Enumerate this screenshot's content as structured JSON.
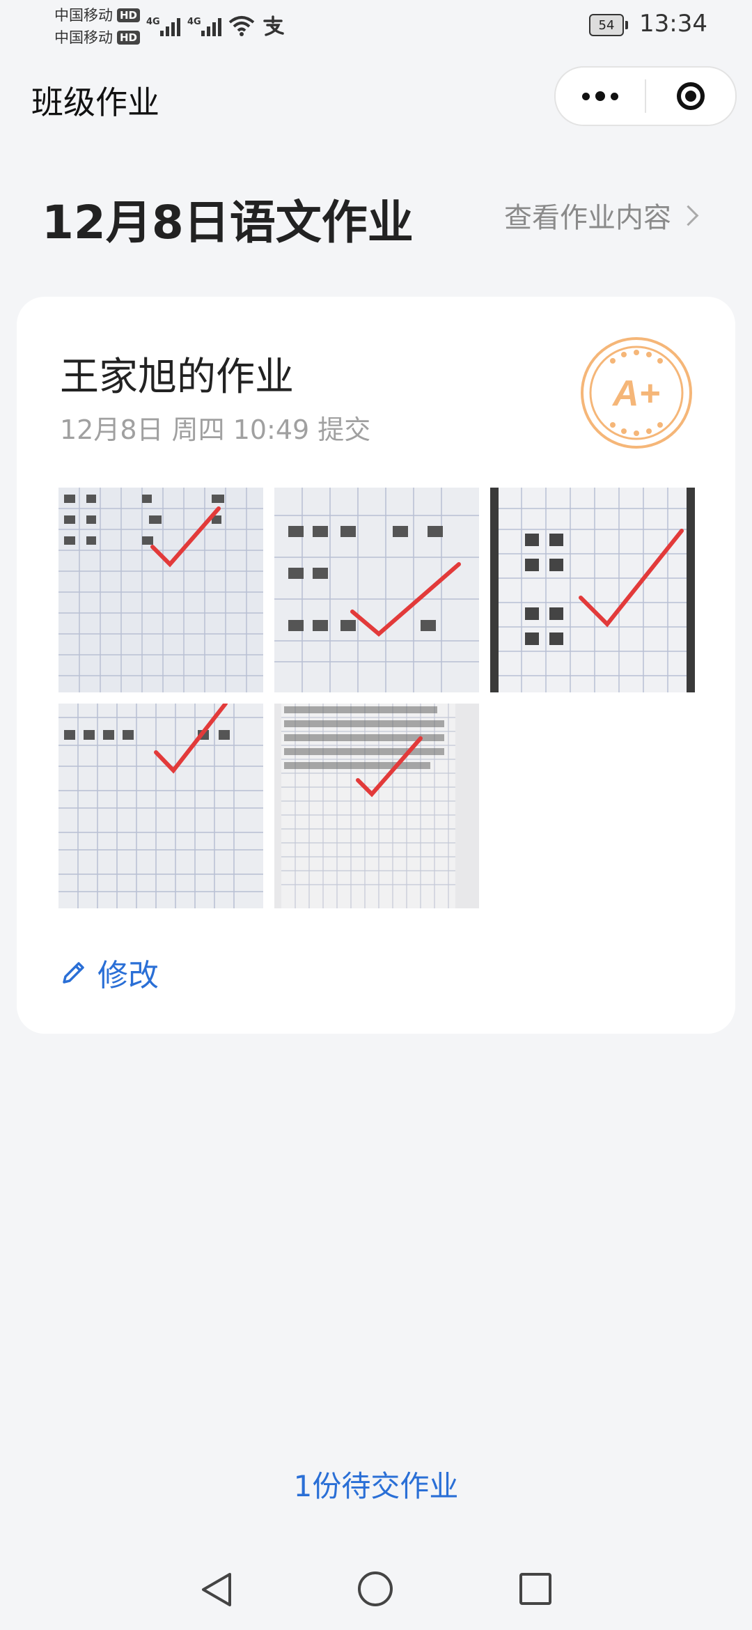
{
  "status_bar": {
    "carrier_1": "中国移动",
    "carrier_2": "中国移动",
    "hd_badge": "HD",
    "network_1": "4G",
    "network_2": "4G",
    "battery": "54",
    "time": "13:34",
    "icons": [
      "signal-icon",
      "signal-icon",
      "wifi-icon",
      "alipay-icon",
      "battery-icon"
    ]
  },
  "app_bar": {
    "title": "班级作业",
    "icons": [
      "more-icon",
      "close-target-icon"
    ]
  },
  "homework": {
    "title": "12月8日语文作业",
    "view_content_label": "查看作业内容",
    "view_content_icon": "chevron-right-icon"
  },
  "submission": {
    "owner_title": "王家旭的作业",
    "submitted_at": "12月8日 周四 10:49 提交",
    "grade": "A+",
    "grade_color": "#f5b678",
    "photo_count": 5,
    "photos": [
      {
        "label": "homework-photo-1"
      },
      {
        "label": "homework-photo-2"
      },
      {
        "label": "homework-photo-3"
      },
      {
        "label": "homework-photo-4"
      },
      {
        "label": "homework-photo-5"
      }
    ],
    "edit_label": "修改",
    "edit_icon": "pencil-icon"
  },
  "pending_label": "1份待交作业",
  "colors": {
    "accent": "#2a6fd6",
    "check_mark": "#e23a3a",
    "background": "#f4f5f7"
  },
  "system_nav": {
    "icons": [
      "back-icon",
      "home-icon",
      "recent-apps-icon"
    ]
  }
}
